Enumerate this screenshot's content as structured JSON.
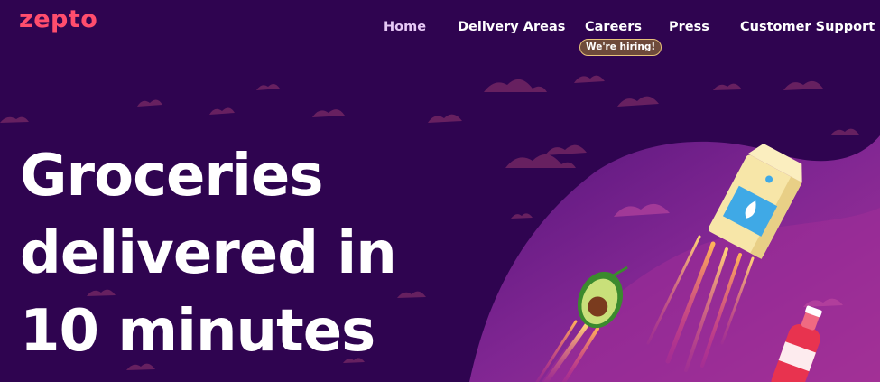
{
  "brand": {
    "logo_text": "zepto",
    "logo_color": "#ff4d6d"
  },
  "nav": {
    "items": [
      {
        "label": "Home",
        "active": true
      },
      {
        "label": "Delivery Areas",
        "active": false
      },
      {
        "label": "Careers",
        "active": false
      },
      {
        "label": "Press",
        "active": false
      },
      {
        "label": "Customer Support",
        "active": false
      }
    ],
    "careers_badge": "We're hiring!"
  },
  "hero": {
    "lines": [
      "Groceries",
      "delivered in",
      "10 minutes"
    ]
  },
  "colors": {
    "background": "#2f0450",
    "cloud": "#8a2f6a",
    "wave": "#6b1d82",
    "accent_pink": "#ff4d6d"
  },
  "illustration": {
    "icons": [
      "milk-carton-icon",
      "avocado-icon",
      "soda-bottle-icon"
    ]
  }
}
